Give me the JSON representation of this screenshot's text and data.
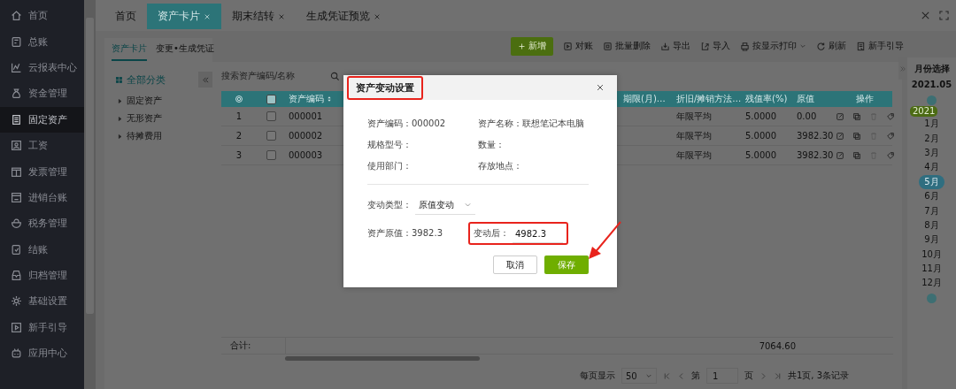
{
  "sidebar": {
    "items": [
      {
        "label": "首页",
        "selected": false
      },
      {
        "label": "总账",
        "selected": false
      },
      {
        "label": "云报表中心",
        "selected": false
      },
      {
        "label": "资金管理",
        "selected": false
      },
      {
        "label": "固定资产",
        "selected": true
      },
      {
        "label": "工资",
        "selected": false
      },
      {
        "label": "发票管理",
        "selected": false
      },
      {
        "label": "进销台账",
        "selected": false
      },
      {
        "label": "税务管理",
        "selected": false
      },
      {
        "label": "结账",
        "selected": false
      },
      {
        "label": "归档管理",
        "selected": false
      },
      {
        "label": "基础设置",
        "selected": false
      },
      {
        "label": "新手引导",
        "selected": false
      },
      {
        "label": "应用中心",
        "selected": false
      }
    ]
  },
  "tabs": [
    {
      "label": "首页",
      "closable": false,
      "selected": false
    },
    {
      "label": "资产卡片",
      "closable": true,
      "selected": true
    },
    {
      "label": "期末结转",
      "closable": true,
      "selected": false
    },
    {
      "label": "生成凭证预览",
      "closable": true,
      "selected": false
    }
  ],
  "subtabs": [
    {
      "label": "资产卡片",
      "selected": true
    },
    {
      "label": "变更•生成凭证",
      "selected": false
    }
  ],
  "category_tree": {
    "title": "全部分类",
    "items": [
      {
        "label": "固定资产"
      },
      {
        "label": "无形资产"
      },
      {
        "label": "待摊费用"
      }
    ]
  },
  "search": {
    "placeholder": "搜索资产编码/名称"
  },
  "toolbar": [
    {
      "label": "新增",
      "kind": "primary"
    },
    {
      "label": "对账",
      "kind": "plain"
    },
    {
      "label": "批量删除",
      "kind": "plain"
    },
    {
      "label": "导出",
      "kind": "plain"
    },
    {
      "label": "导入",
      "kind": "plain"
    },
    {
      "label": "按显示打印",
      "kind": "dropdown"
    },
    {
      "label": "刷新",
      "kind": "plain"
    },
    {
      "label": "新手引导",
      "kind": "plain"
    }
  ],
  "table": {
    "all_checked": false,
    "columns": [
      "资产编码",
      "期限(月)…",
      "折旧/摊销方法…",
      "残值率(%)",
      "原值",
      "操作"
    ],
    "rows": [
      {
        "index": "1",
        "checked": false,
        "code": "000001",
        "method": "年限平均",
        "rate": "5.0000",
        "value": "0.00"
      },
      {
        "index": "2",
        "checked": false,
        "code": "000002",
        "method": "年限平均",
        "rate": "5.0000",
        "value": "3982.30"
      },
      {
        "index": "3",
        "checked": false,
        "code": "000003",
        "method": "年限平均",
        "rate": "5.0000",
        "value": "3982.30"
      }
    ],
    "footer": {
      "label": "合计:",
      "total": "7064.60"
    }
  },
  "pagination": {
    "per_page_label": "每页显示",
    "per_page": "50",
    "page_prefix": "第",
    "page": "1",
    "page_suffix": "页",
    "summary": "共1页, 3条记录"
  },
  "month_panel": {
    "title": "月份选择",
    "current": "2021.05",
    "year": "2021",
    "months": [
      {
        "label": "1月",
        "selected": false
      },
      {
        "label": "2月",
        "selected": false
      },
      {
        "label": "3月",
        "selected": false
      },
      {
        "label": "4月",
        "selected": false
      },
      {
        "label": "5月",
        "selected": true
      },
      {
        "label": "6月",
        "selected": false
      },
      {
        "label": "7月",
        "selected": false
      },
      {
        "label": "8月",
        "selected": false
      },
      {
        "label": "9月",
        "selected": false
      },
      {
        "label": "10月",
        "selected": false
      },
      {
        "label": "11月",
        "selected": false
      },
      {
        "label": "12月",
        "selected": false
      }
    ]
  },
  "dialog": {
    "title": "资产变动设置",
    "title_highlighted": true,
    "fields": [
      {
        "label": "资产编码：",
        "value": "000002"
      },
      {
        "label": "资产名称：",
        "value": "联想笔记本电脑"
      },
      {
        "label": "规格型号："
      },
      {
        "label": "数量："
      },
      {
        "label": "使用部门："
      },
      {
        "label": "存放地点："
      }
    ],
    "change_type": {
      "label": "变动类型：",
      "value": "原值变动"
    },
    "original": {
      "label": "资产原值：",
      "value": "3982.3"
    },
    "after": {
      "label": "变动后：",
      "value": "4982.3",
      "highlighted": true
    },
    "pointer_arrow": true,
    "buttons": [
      {
        "label": "取消",
        "kind": "secondary"
      },
      {
        "label": "保存",
        "kind": "primary"
      }
    ]
  }
}
